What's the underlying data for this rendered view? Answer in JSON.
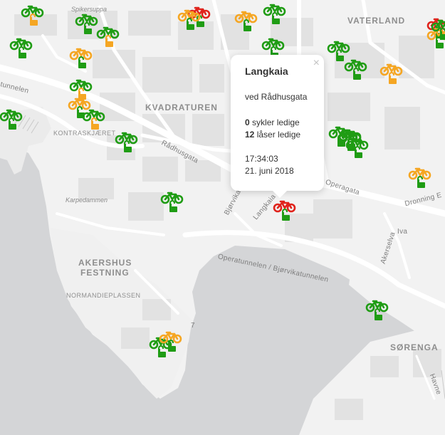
{
  "map": {
    "labels": {
      "spikersuppa": "Spikersuppa",
      "vaterland": "VATERLAND",
      "kvadraturen": "KVADRATUREN",
      "kontraskjaeret": "KONTRASKJÆRET",
      "karpedammen": "Karpedammen",
      "akershus_1": "AKERSHUS",
      "akershus_2": "FESTNING",
      "normandieplassen": "NORMANDIEPLASSEN",
      "sorenga": "SØRENGA",
      "radhusgata": "Rådhusgata",
      "operagata": "Operagata",
      "dronning": "Dronning E",
      "operatunnelen": "Operatunnelen / Bjørvikatunnelen",
      "tunnelen": "tunnelen",
      "akersetva": "Akerselva",
      "iva": "Iva",
      "langkaia_road": "Langkaia",
      "bjorvika": "Bjørvikatunnelen",
      "route_7": "7",
      "havnebassenget": "Havne"
    },
    "status_colors": {
      "available": "#1f9c14",
      "few": "#f5a623",
      "empty": "#e0231c"
    }
  },
  "popup": {
    "title": "Langkaia",
    "address": "ved Rådhusgata",
    "bikes_count": "0",
    "bikes_label": "sykler ledige",
    "locks_count": "12",
    "locks_label": "låser ledige",
    "time": "17:34:03",
    "date": "21. juni 2018",
    "close": "×"
  },
  "stations": [
    {
      "bike": "green",
      "lock": "orange"
    },
    {
      "bike": "green",
      "lock": "green"
    },
    {
      "bike": "red",
      "lock": "green"
    },
    {
      "bike": "orange",
      "lock": "green"
    },
    {
      "bike": "orange",
      "lock": "green"
    },
    {
      "bike": "green",
      "lock": "green"
    },
    {
      "bike": "orange",
      "lock": "green"
    },
    {
      "bike": "green",
      "lock": "orange"
    },
    {
      "bike": "green",
      "lock": "green"
    },
    {
      "bike": "green",
      "lock": "orange"
    },
    {
      "bike": "orange",
      "lock": "green"
    },
    {
      "bike": "green",
      "lock": "green"
    },
    {
      "bike": "green",
      "lock": "green"
    },
    {
      "bike": "green",
      "lock": "green"
    },
    {
      "bike": "red",
      "lock": "green"
    },
    {
      "bike": "green",
      "lock": "green"
    },
    {
      "bike": "orange",
      "lock": "orange"
    },
    {
      "bike": "green",
      "lock": "green"
    },
    {
      "bike": "green",
      "lock": "orange"
    },
    {
      "bike": "green",
      "lock": "green"
    },
    {
      "bike": "green",
      "lock": "green"
    },
    {
      "bike": "green",
      "lock": "green"
    },
    {
      "bike": "orange",
      "lock": "green"
    },
    {
      "bike": "orange",
      "lock": "green"
    },
    {
      "bike": "red",
      "lock": "green"
    },
    {
      "bike": "green",
      "lock": "green"
    },
    {
      "bike": "orange",
      "lock": "green"
    },
    {
      "bike": "green",
      "lock": "green"
    },
    {
      "bike": "green",
      "lock": "green"
    },
    {
      "bike": "green",
      "lock": "green"
    },
    {
      "bike": "green",
      "lock": "green"
    }
  ]
}
